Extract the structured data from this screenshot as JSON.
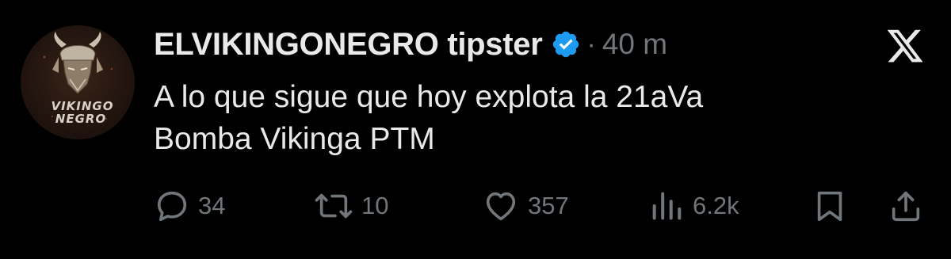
{
  "author": {
    "display_name": "ELVIKINGONEGRO tipster",
    "verified": true,
    "separator": "·",
    "time": "40 m",
    "avatar": {
      "line1": "VIKINGO",
      "line2": "NEGRO",
      "icon": "viking-helmet-logo"
    }
  },
  "platform": {
    "logo": "x-logo"
  },
  "tweet": {
    "text": "A lo que sigue que hoy explota la 21aVa\nBomba Vikinga PTM"
  },
  "actions": {
    "reply": {
      "icon": "reply-icon",
      "count": "34"
    },
    "retweet": {
      "icon": "retweet-icon",
      "count": "10"
    },
    "like": {
      "icon": "heart-icon",
      "count": "357"
    },
    "views": {
      "icon": "views-icon",
      "count": "6.2k"
    },
    "bookmark": {
      "icon": "bookmark-icon"
    },
    "share": {
      "icon": "share-icon"
    }
  },
  "colors": {
    "background": "#000000",
    "primary_text": "#e7e9ea",
    "secondary_text": "#71767b",
    "verified_badge": "#1d9bf0"
  }
}
